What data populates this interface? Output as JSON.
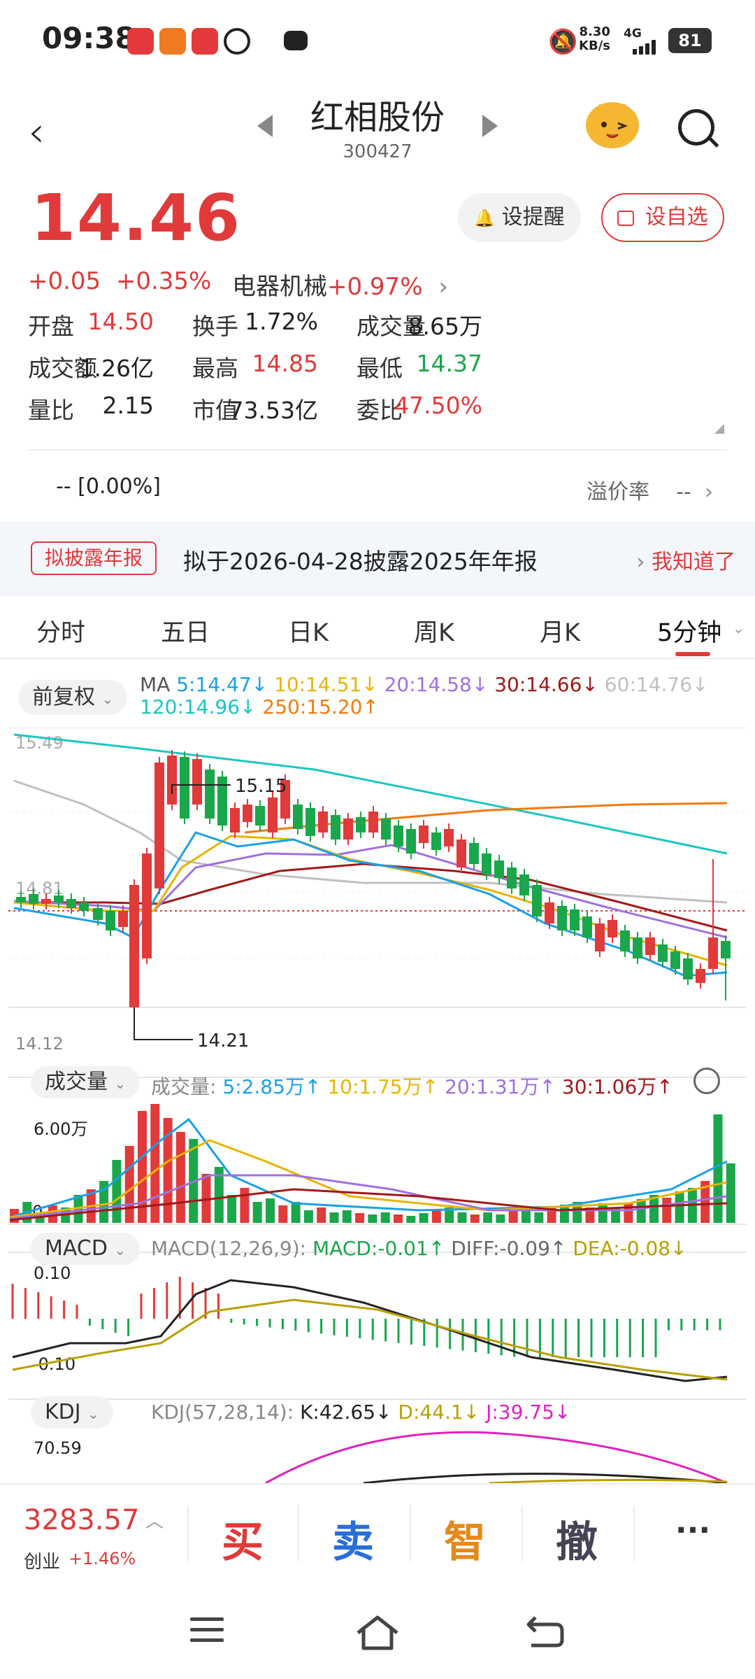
{
  "status_bar": {
    "time": "09:38",
    "net_speed": "8.30",
    "net_unit": "KB/s",
    "network": "4G",
    "battery": "81"
  },
  "header": {
    "title": "红相股份",
    "code": "300427"
  },
  "quote": {
    "price": "14.46",
    "change": "+0.05",
    "change_pct": "+0.35%",
    "sector": "电器机械",
    "sector_pct": "+0.97%",
    "alert_button": "设提醒",
    "favorite_button": "设自选"
  },
  "stats": [
    [
      {
        "label": "开盘",
        "value": "14.50",
        "color": "red"
      },
      {
        "label": "换手",
        "value": "1.72%",
        "color": "dark"
      },
      {
        "label": "成交量",
        "value": "8.65万",
        "color": "dark"
      }
    ],
    [
      {
        "label": "成交额",
        "value": "1.26亿",
        "color": "dark"
      },
      {
        "label": "最高",
        "value": "14.85",
        "color": "red"
      },
      {
        "label": "最低",
        "value": "14.37",
        "color": "green"
      }
    ],
    [
      {
        "label": "量比",
        "value": "2.15",
        "color": "dark"
      },
      {
        "label": "市值",
        "value": "73.53亿",
        "color": "dark"
      },
      {
        "label": "委比",
        "value": "47.50%",
        "color": "red"
      }
    ]
  ],
  "premium": {
    "left": "--  [0.00%]",
    "label": "溢价率",
    "value": "--"
  },
  "notice": {
    "tag": "拟披露年报",
    "text": "拟于2026-04-28披露2025年年报",
    "action": "我知道了"
  },
  "tabs": [
    "分时",
    "五日",
    "日K",
    "周K",
    "月K",
    "5分钟"
  ],
  "active_tab": "5分钟",
  "ma": {
    "mode": "前复权",
    "label": "MA",
    "items": [
      {
        "text": "5:14.47↓",
        "color": "#1aa0e8"
      },
      {
        "text": "10:14.51↓",
        "color": "#e8b400"
      },
      {
        "text": "20:14.58↓",
        "color": "#a070e0"
      },
      {
        "text": "30:14.66↓",
        "color": "#a01818"
      },
      {
        "text": "60:14.76↓",
        "color": "#c0c0c0"
      },
      {
        "text": "120:14.96↓",
        "color": "#1cc6c0"
      },
      {
        "text": "250:15.20↑",
        "color": "#f07a10"
      }
    ]
  },
  "kline_labels": {
    "top_axis": "15.49",
    "mid_axis": "14.81",
    "bottom_axis": "14.12",
    "high_marker": "15.15",
    "low_marker": "14.21"
  },
  "volume": {
    "mode": "成交量",
    "label": "成交量:",
    "items": [
      {
        "text": "5:2.85万↑",
        "color": "#1aa0e8"
      },
      {
        "text": "10:1.75万↑",
        "color": "#e8b400"
      },
      {
        "text": "20:1.31万↑",
        "color": "#a070e0"
      },
      {
        "text": "30:1.06万↑",
        "color": "#a01818"
      }
    ],
    "axis_top": "6.00万",
    "axis_bottom": "0"
  },
  "macd": {
    "mode": "MACD",
    "label": "MACD(12,26,9):",
    "items": [
      {
        "text": "MACD:-0.01↑",
        "color": "#1aa64a"
      },
      {
        "text": "DIFF:-0.09↑",
        "color": "#666666"
      },
      {
        "text": "DEA:-0.08↓",
        "color": "#b8a000"
      }
    ],
    "axis_top": "0.10",
    "axis_bottom": "-0.10"
  },
  "kdj": {
    "mode": "KDJ",
    "label": "KDJ(57,28,14):",
    "items": [
      {
        "text": "K:42.65↓",
        "color": "#222222"
      },
      {
        "text": "D:44.1↓",
        "color": "#b8a000"
      },
      {
        "text": "J:39.75↓",
        "color": "#e020c0"
      }
    ],
    "axis_top": "70.59"
  },
  "bottom_bar": {
    "index_value": "3283.57",
    "index_name": "创业",
    "index_pct": "+1.46%",
    "buy": "买",
    "sell": "卖",
    "smart": "智",
    "cancel": "撤",
    "more": "···"
  },
  "colors": {
    "up": "#e03a3a",
    "down": "#1aa64a",
    "accent": "#e03a3a"
  }
}
